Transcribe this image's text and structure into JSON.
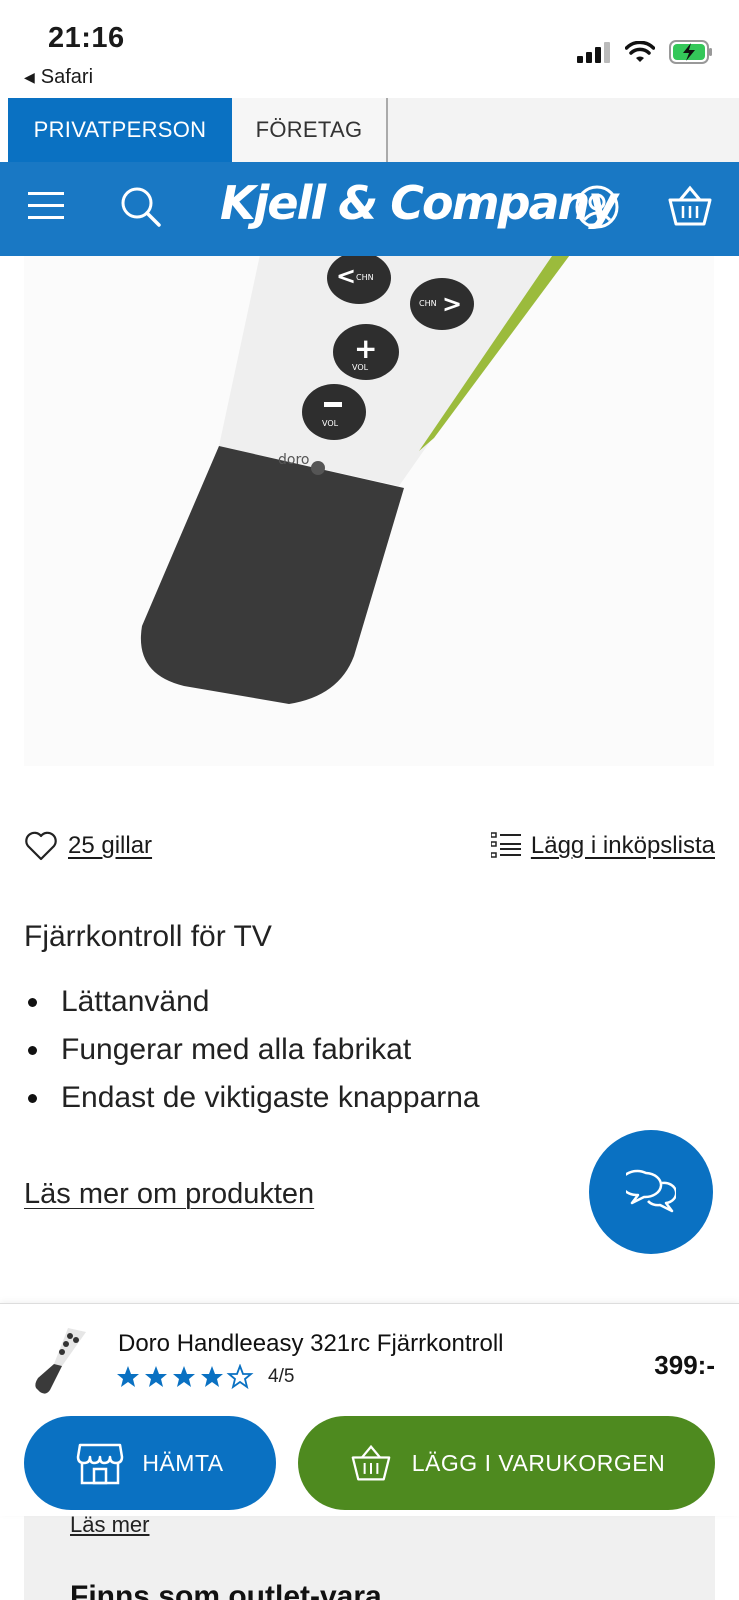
{
  "status_bar": {
    "time": "21:16",
    "back_app": "Safari"
  },
  "segments": {
    "private": "PRIVATPERSON",
    "business": "FÖRETAG"
  },
  "header": {
    "logo_text": "Kjell & Company",
    "brand_color": "#0a71c2"
  },
  "actions": {
    "likes_label": "25 gillar",
    "shopping_list_label": "Lägg i inköpslista"
  },
  "product": {
    "subtitle": "Fjärrkontroll för TV",
    "features": [
      "Lättanvänd",
      "Fungerar med alla fabrikat",
      "Endast de viktigaste knapparna"
    ],
    "read_more": "Läs mer om produkten",
    "remote_buttons": {
      "chn_left": "CHN",
      "chn_right": "CHN",
      "vol_plus": "VOL",
      "vol_minus": "VOL",
      "brand": "doro"
    }
  },
  "sticky": {
    "name": "Doro Handleeasy 321rc Fjärrkontroll",
    "rating": 4,
    "rating_text": "4/5",
    "price": "399:-",
    "pickup_label": "HÄMTA",
    "cart_label": "LÄGG I VARUKORGEN",
    "accent_green": "#4e8a1f"
  },
  "below": {
    "link_text": "Läs mer",
    "title": "Finns som outlet-vara"
  }
}
